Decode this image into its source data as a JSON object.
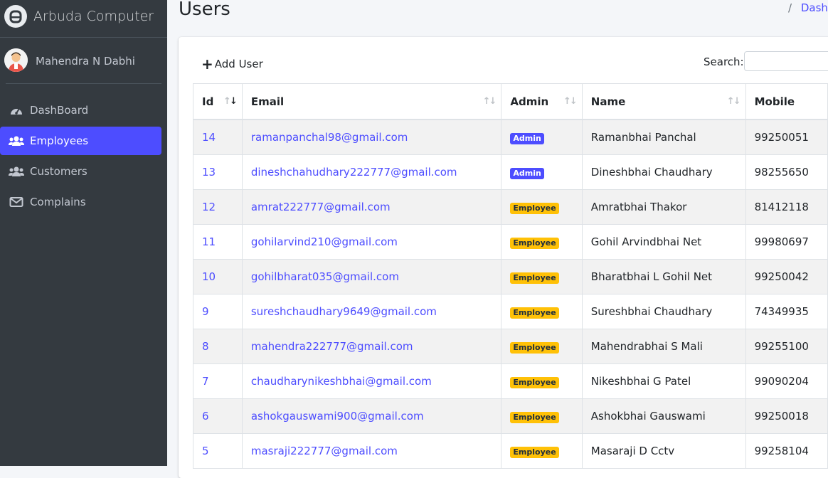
{
  "brand": {
    "name": "Arbuda Computer",
    "logo_icon": "a-logo-icon"
  },
  "user": {
    "name": "Mahendra N Dabhi"
  },
  "nav": {
    "items": [
      {
        "label": "DashBoard",
        "icon": "tachometer-icon",
        "active": false
      },
      {
        "label": "Employees",
        "icon": "users-icon",
        "active": true
      },
      {
        "label": "Customers",
        "icon": "users-icon",
        "active": false
      },
      {
        "label": "Complains",
        "icon": "envelope-icon",
        "active": false
      }
    ]
  },
  "page": {
    "title": "Users",
    "breadcrumb_sep": "/",
    "breadcrumb_link": "Dashb"
  },
  "toolbar": {
    "add_user_icon": "+",
    "add_user_label": "Add User",
    "search_label": "Search:",
    "search_value": ""
  },
  "table": {
    "columns": [
      "Id",
      "Email",
      "Admin",
      "Name",
      "Mobile"
    ],
    "rows": [
      {
        "id": "14",
        "email": "ramanpanchal98@gmail.com",
        "role": "Admin",
        "name": "Ramanbhai Panchal",
        "mobile": "99250051"
      },
      {
        "id": "13",
        "email": "dineshchahudhary222777@gmail.com",
        "role": "Admin",
        "name": "Dineshbhai Chaudhary",
        "mobile": "98255650"
      },
      {
        "id": "12",
        "email": "amrat222777@gmail.com",
        "role": "Employee",
        "name": "Amratbhai Thakor",
        "mobile": "81412118"
      },
      {
        "id": "11",
        "email": "gohilarvind210@gmail.com",
        "role": "Employee",
        "name": "Gohil Arvindbhai Net",
        "mobile": "99980697"
      },
      {
        "id": "10",
        "email": "gohilbharat035@gmail.com",
        "role": "Employee",
        "name": "Bharatbhai L Gohil Net",
        "mobile": "99250042"
      },
      {
        "id": "9",
        "email": "sureshchaudhary9649@gmail.com",
        "role": "Employee",
        "name": "Sureshbhai Chaudhary",
        "mobile": "74349935"
      },
      {
        "id": "8",
        "email": "mahendra222777@gmail.com",
        "role": "Employee",
        "name": "Mahendrabhai S Mali",
        "mobile": "99255100"
      },
      {
        "id": "7",
        "email": "chaudharynikeshbhai@gmail.com",
        "role": "Employee",
        "name": "Nikeshbhai G Patel",
        "mobile": "99090204"
      },
      {
        "id": "6",
        "email": "ashokgauswami900@gmail.com",
        "role": "Employee",
        "name": "Ashokbhai Gauswami",
        "mobile": "99250018"
      },
      {
        "id": "5",
        "email": "masraji222777@gmail.com",
        "role": "Employee",
        "name": "Masaraji D Cctv",
        "mobile": "99258104"
      }
    ]
  },
  "colors": {
    "sidebar": "#343a40",
    "accent": "#4d4dff",
    "employee_badge": "#ffc107"
  }
}
